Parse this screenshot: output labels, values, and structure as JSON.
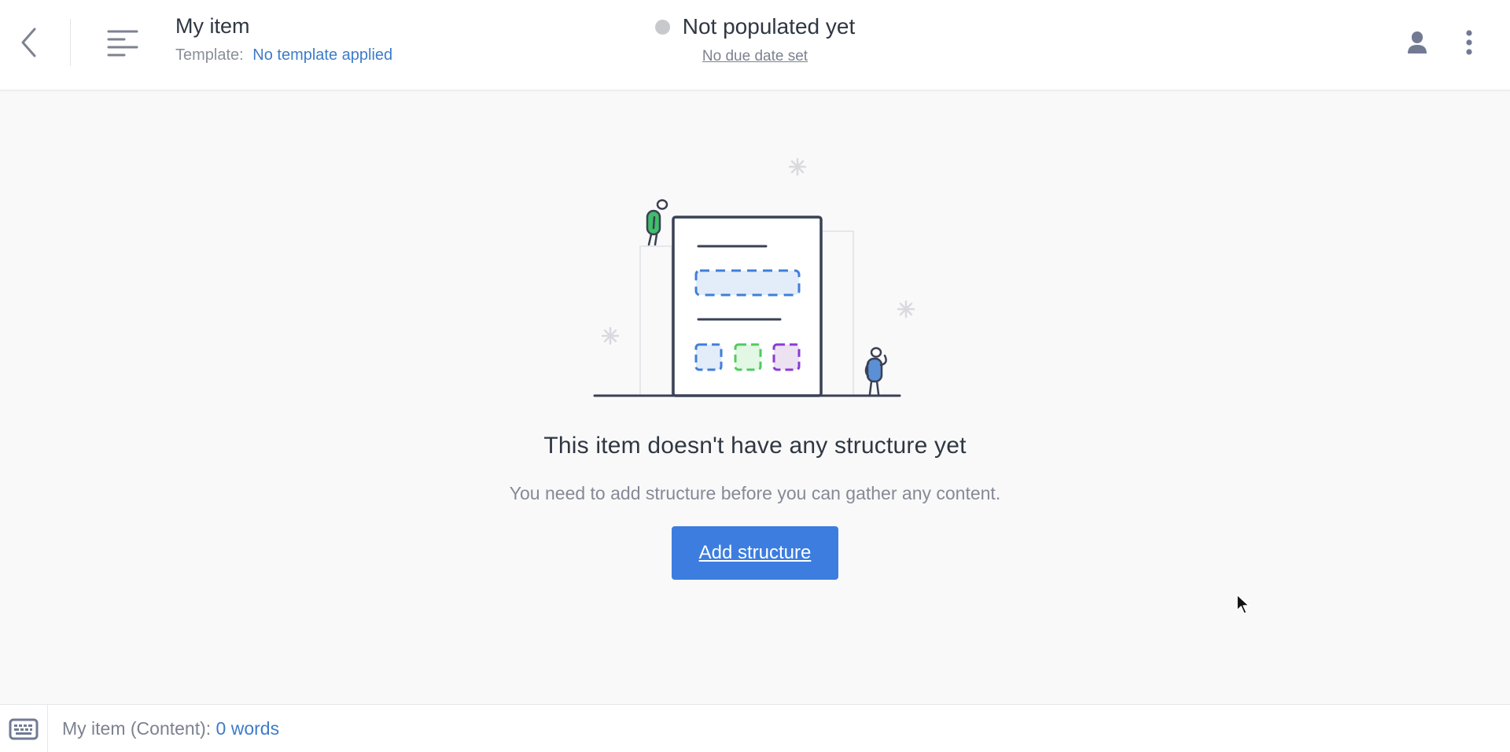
{
  "header": {
    "back_icon": "chevron-left-icon",
    "outline_icon": "outline-lines-icon",
    "item_title": "My item",
    "template_label": "Template:",
    "template_value": "No template applied",
    "status": {
      "label": "Not populated yet",
      "color": "#c8c9cc"
    },
    "due_date": "No due date set",
    "user_icon": "person-icon",
    "more_icon": "more-vertical-icon"
  },
  "empty_state": {
    "illustration": "document-structure-illustration",
    "heading": "This item doesn't have any structure yet",
    "subtext": "You need to add structure before you can gather any content.",
    "button_label": "Add structure",
    "button_color": "#3c7ddf"
  },
  "footer": {
    "keyboard_icon": "keyboard-icon",
    "word_count_label": "My item (Content):",
    "word_count_value": "0 words"
  },
  "colors": {
    "accent": "#3d7cc9",
    "text_primary": "#2f3742",
    "text_secondary": "#858a95"
  }
}
